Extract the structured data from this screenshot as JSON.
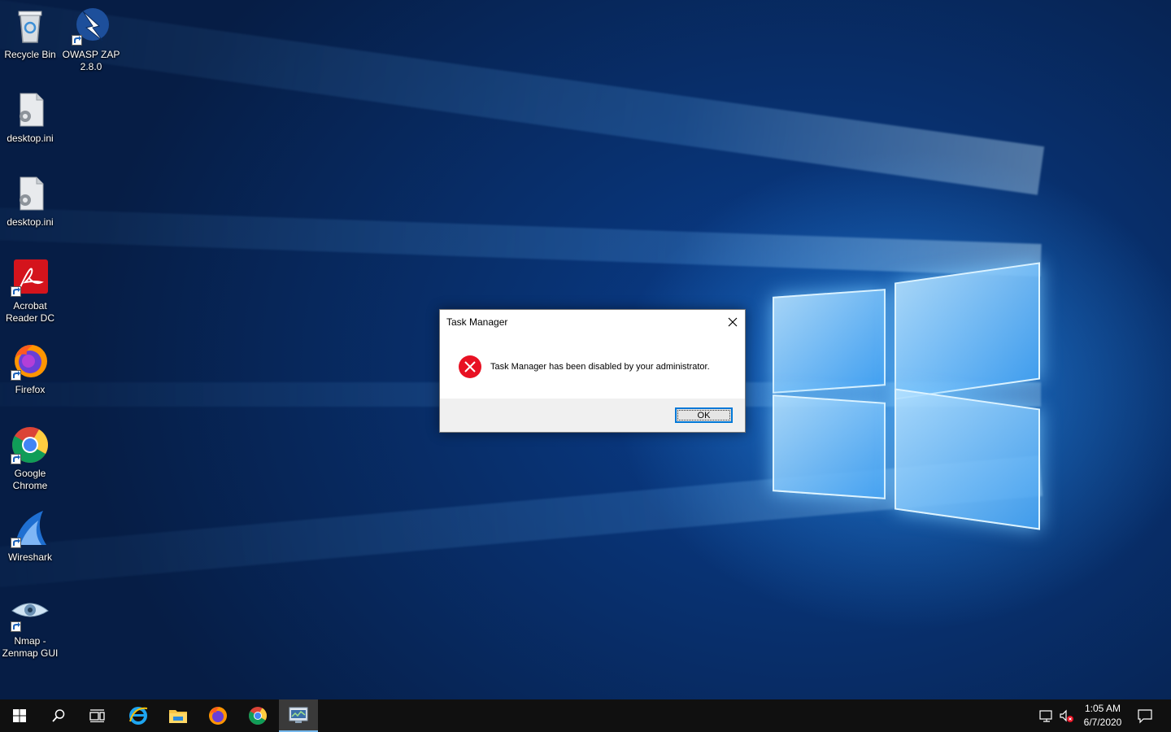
{
  "desktop": {
    "icons": [
      {
        "label": "Recycle Bin"
      },
      {
        "label": "OWASP ZAP 2.8.0"
      },
      {
        "label": "desktop.ini"
      },
      {
        "label": "desktop.ini"
      },
      {
        "label": "Acrobat Reader DC"
      },
      {
        "label": "Firefox"
      },
      {
        "label": "Google Chrome"
      },
      {
        "label": "Wireshark"
      },
      {
        "label": "Nmap - Zenmap GUI"
      }
    ]
  },
  "dialog": {
    "title": "Task Manager",
    "message": "Task Manager has been disabled by your administrator.",
    "ok_label": "OK",
    "icon": "error-icon"
  },
  "taskbar": {
    "items": [
      {
        "icon": "windows-start-icon"
      },
      {
        "icon": "search-icon"
      },
      {
        "icon": "task-view-icon"
      },
      {
        "icon": "internet-explorer-icon"
      },
      {
        "icon": "file-explorer-icon"
      },
      {
        "icon": "firefox-icon"
      },
      {
        "icon": "chrome-icon"
      },
      {
        "icon": "task-manager-icon"
      }
    ],
    "clock_time": "1:05 AM",
    "clock_date": "6/7/2020"
  },
  "colors": {
    "accent": "#0078d7",
    "error": "#e81123",
    "taskbar": "#101010"
  }
}
